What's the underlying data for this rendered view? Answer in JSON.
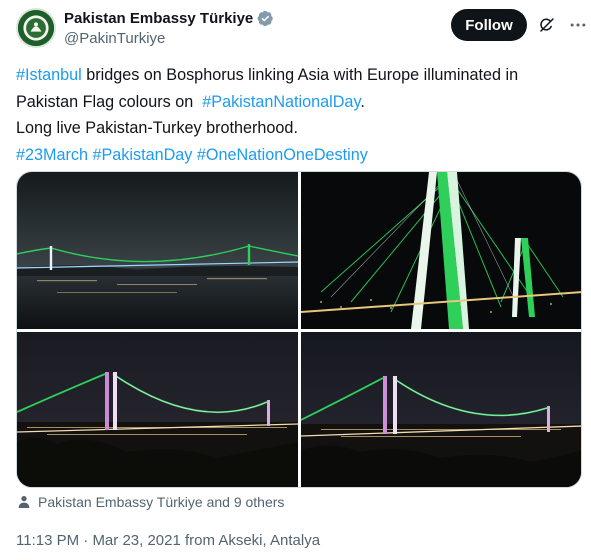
{
  "author": {
    "display_name": "Pakistan Embassy Türkiye",
    "handle": "@PakinTurkiye",
    "verified_icon": "verified-badge-icon",
    "badge_color": "#829aab"
  },
  "actions": {
    "follow_label": "Follow",
    "grok_icon": "grok-icon",
    "more_icon": "more-options-icon"
  },
  "tweet": {
    "line1": {
      "tag": "#Istanbul",
      "text": " bridges on Bosphorus linking Asia with Europe illuminated in"
    },
    "line2": {
      "text": "Pakistan Flag colours on  ",
      "tag": "#PakistanNationalDay",
      "end": "."
    },
    "line3": {
      "text": "Long live Pakistan-Turkey brotherhood."
    },
    "line4": {
      "tag1": "#23March",
      "tag2": "#PakistanDay",
      "tag3": "#OneNationOneDestiny"
    }
  },
  "media": {
    "images": [
      {
        "name": "bridge-far-shot",
        "icon": "photo"
      },
      {
        "name": "bridge-tower-closeup",
        "icon": "photo"
      },
      {
        "name": "bridge-hill-view",
        "icon": "photo"
      },
      {
        "name": "bridge-hill-view-2",
        "icon": "photo"
      }
    ]
  },
  "tagged": {
    "text": "Pakistan Embassy Türkiye and 9 others",
    "icon": "person-icon"
  },
  "meta": {
    "time": "11:13 PM",
    "separator": " · ",
    "date": "Mar 23, 2021",
    "location": " from Akseki, Antalya"
  },
  "colors": {
    "link": "#1d9bf0",
    "text": "#0f1419",
    "muted": "#536471",
    "bridge_green": "#2fd05a"
  }
}
